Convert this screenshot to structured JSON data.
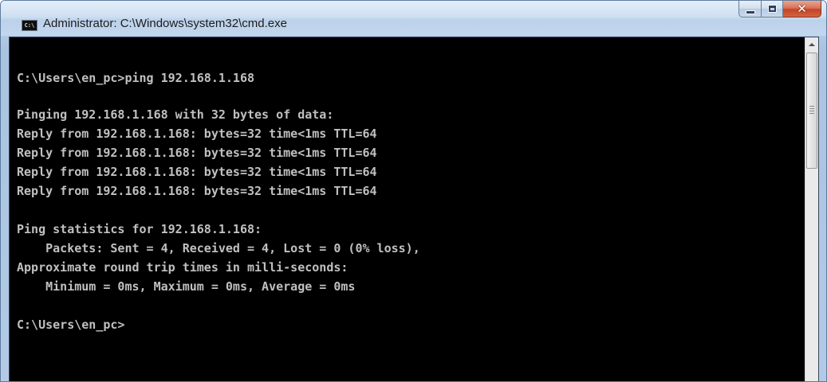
{
  "window": {
    "title": "Administrator: C:\\Windows\\system32\\cmd.exe",
    "app_icon_text": "C:\\",
    "close_glyph": "✕"
  },
  "console": {
    "lines": [
      "C:\\Users\\en_pc>ping 192.168.1.168",
      "",
      "Pinging 192.168.1.168 with 32 bytes of data:",
      "Reply from 192.168.1.168: bytes=32 time<1ms TTL=64",
      "Reply from 192.168.1.168: bytes=32 time<1ms TTL=64",
      "Reply from 192.168.1.168: bytes=32 time<1ms TTL=64",
      "Reply from 192.168.1.168: bytes=32 time<1ms TTL=64",
      "",
      "Ping statistics for 192.168.1.168:",
      "    Packets: Sent = 4, Received = 4, Lost = 0 (0% loss),",
      "Approximate round trip times in milli-seconds:",
      "    Minimum = 0ms, Maximum = 0ms, Average = 0ms",
      "",
      "C:\\Users\\en_pc>"
    ]
  },
  "icons": {
    "app": "cmd-icon",
    "minimize": "minimize-icon",
    "maximize": "maximize-icon",
    "close": "close-icon",
    "scroll_up": "chevron-up-icon"
  },
  "colors": {
    "console_background": "#000000",
    "console_text": "#c0c0c0",
    "close_button": "#c2452a"
  }
}
